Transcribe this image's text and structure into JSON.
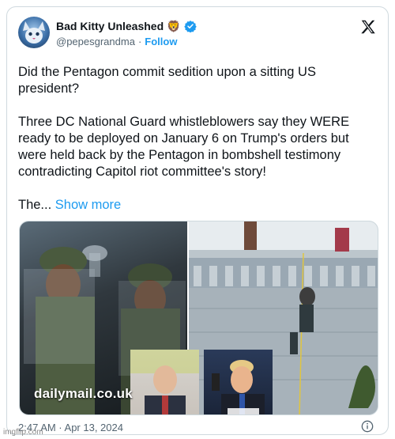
{
  "tweet": {
    "author_name": "Bad Kitty Unleashed",
    "author_emoji": "🦁",
    "handle": "@pepesgrandma",
    "separator": "·",
    "follow_label": "Follow",
    "paragraph1": "Did the Pentagon commit sedition upon a sitting US president?",
    "paragraph2": "Three DC National Guard whistleblowers say they WERE ready to be deployed on January 6 on Trump's orders but were held back by the Pentagon in bombshell testimony contradicting Capitol riot committee's story!",
    "truncated": "The...",
    "show_more_label": "Show more",
    "media_source": "dailymail.co.uk",
    "timestamp": "2:47 AM · Apr 13, 2024"
  },
  "watermark": "imgflip.com",
  "colors": {
    "accent": "#1d9bf0",
    "text": "#0f1419",
    "muted": "#536471",
    "border": "#cfd9de"
  },
  "icons": [
    "avatar-cat",
    "verified-badge-icon",
    "x-logo-icon",
    "info-icon"
  ]
}
